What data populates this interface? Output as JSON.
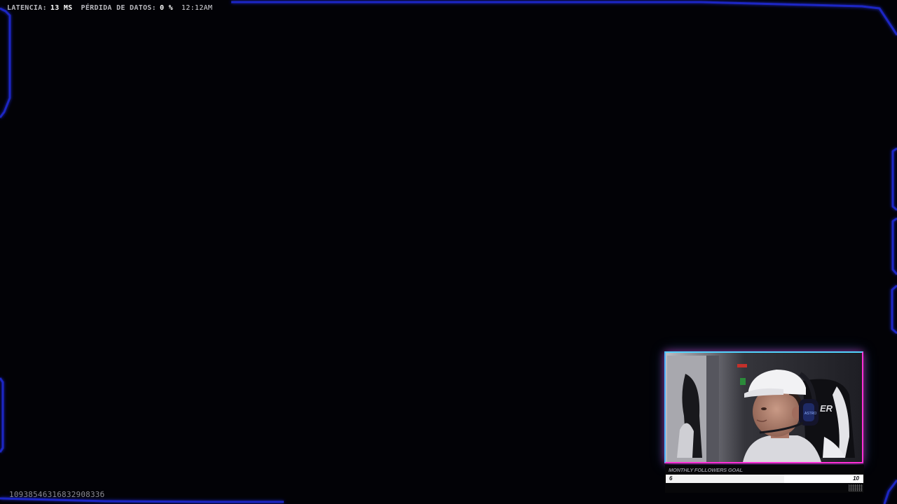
{
  "status_bar": {
    "latency_label": "LATENCIA:",
    "latency_value": "13 MS",
    "loss_label": "PÉRDIDA DE DATOS:",
    "loss_value": "0 %",
    "time": "12:12AM"
  },
  "stream_id": "1093854631683290833б",
  "webcam": {
    "border_top_color": "#52d4ff",
    "border_bottom_color": "#ff2fd6"
  },
  "followers_goal": {
    "title": "MONTHLY FOLLOWERS GOAL",
    "current": "6",
    "target": "10",
    "progress_fraction": 0.6
  },
  "colors": {
    "frame_blue": "#1d22b8",
    "frame_glow": "#2b35ff",
    "background": "#020206"
  }
}
